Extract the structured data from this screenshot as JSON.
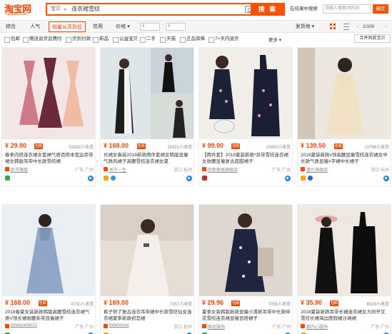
{
  "header": {
    "logo_cn": "淘宝网",
    "logo_en": "Taobao.com",
    "search_type": "宝贝",
    "search_query": "连衣裙雪纺",
    "search_button": "搜 索",
    "within_label": "在结果中搜索",
    "within_placeholder": "请输入搜索词的词",
    "confirm_button": "确定"
  },
  "sortbar": {
    "items": [
      {
        "label": "综合",
        "active": false
      },
      {
        "label": "人气",
        "active": false
      },
      {
        "label": "销量从高到低",
        "active": true
      },
      {
        "label": "信用",
        "active": false
      },
      {
        "label": "价格 ▾",
        "active": false
      }
    ],
    "price_from": "¥",
    "price_to": "¥",
    "price_dash": "-",
    "ship_from": "发货地 ▾",
    "pager": "1/100"
  },
  "filters": {
    "items": [
      "包邮",
      "赠送退货运费险",
      "货到付款",
      "新品",
      "公益宝贝",
      "二手",
      "天猫",
      "正品保障",
      "7+天内退货"
    ],
    "more": "更多 ▾",
    "compare": "合并同款宝贝"
  },
  "products": [
    {
      "price": "¥ 29.90",
      "mark": "包邮",
      "sold": "53330人收货",
      "title": "春季内搭连衣裙女套裙气质百搭本宽边吊带裙女韩版吊带中长款雪纺裙",
      "shop": "百芬旗舰",
      "location": "广东 广州"
    },
    {
      "price": "¥ 168.00",
      "mark": "包邮",
      "sold": "15421人收货",
      "title": "长裙女春装2018新款两件套裙女韩版显瘦气质风裙子高腰雪纺连衣裙女夏",
      "shop": "关于一生",
      "location": "浙江 杭州"
    },
    {
      "price": "¥ 99.90",
      "mark": "包邮",
      "sold": "10863人收货",
      "title": "【两件套】2018夏装新款*吊带雪纺连衣裙女收腰显瘦复古超甜裙子",
      "shop": "优熙家居旗舰店",
      "location": "广东 广州"
    },
    {
      "price": "¥ 139.50",
      "mark": "包邮",
      "sold": "10798人收货",
      "title": "2018夏装新款v领高腰显瘦雪纺连衣裙女中长款气质显瘦#字裙中长裙子",
      "shop": "蓝叶旗舰店",
      "location": "浙江 杭州"
    },
    {
      "price": "¥ 168.00",
      "mark": "包邮",
      "sold": "8750人收货",
      "title": "2018春夏女装新款韩版高腰雪纺连衣裙气质V领长裙收腰系带显瘦裙子",
      "shop": "yetaiyuebin22",
      "location": "广东 广州"
    },
    {
      "price": "¥ 169.00",
      "mark": "",
      "sold": "7357人收货",
      "title": "裤子熟了复古连衣吊带裙中长款雪纺仙女连衣裙夏季新款初恋裙",
      "shop": "belahouse",
      "location": "浙江 杭州"
    },
    {
      "price": "¥ 29.96",
      "mark": "包邮",
      "sold": "7055人收货",
      "title": "夏季女装韩版新款显瘦小清新吊带中长款碎花雪纺连衣裙显瘦百搭裙子",
      "shop": "宾达服饰",
      "location": "广东 广州"
    },
    {
      "price": "¥ 35.90",
      "mark": "包邮",
      "sold": "6929人收货",
      "title": "2018夏装新款吊带长裙连衣裙女大码开叉雪纺长裙海边度假裙沙滩裙",
      "shop": "朝内心服饰",
      "location": "广东 广州"
    }
  ],
  "colors": {
    "accent": "#ff5000",
    "price": "#ff4400"
  }
}
